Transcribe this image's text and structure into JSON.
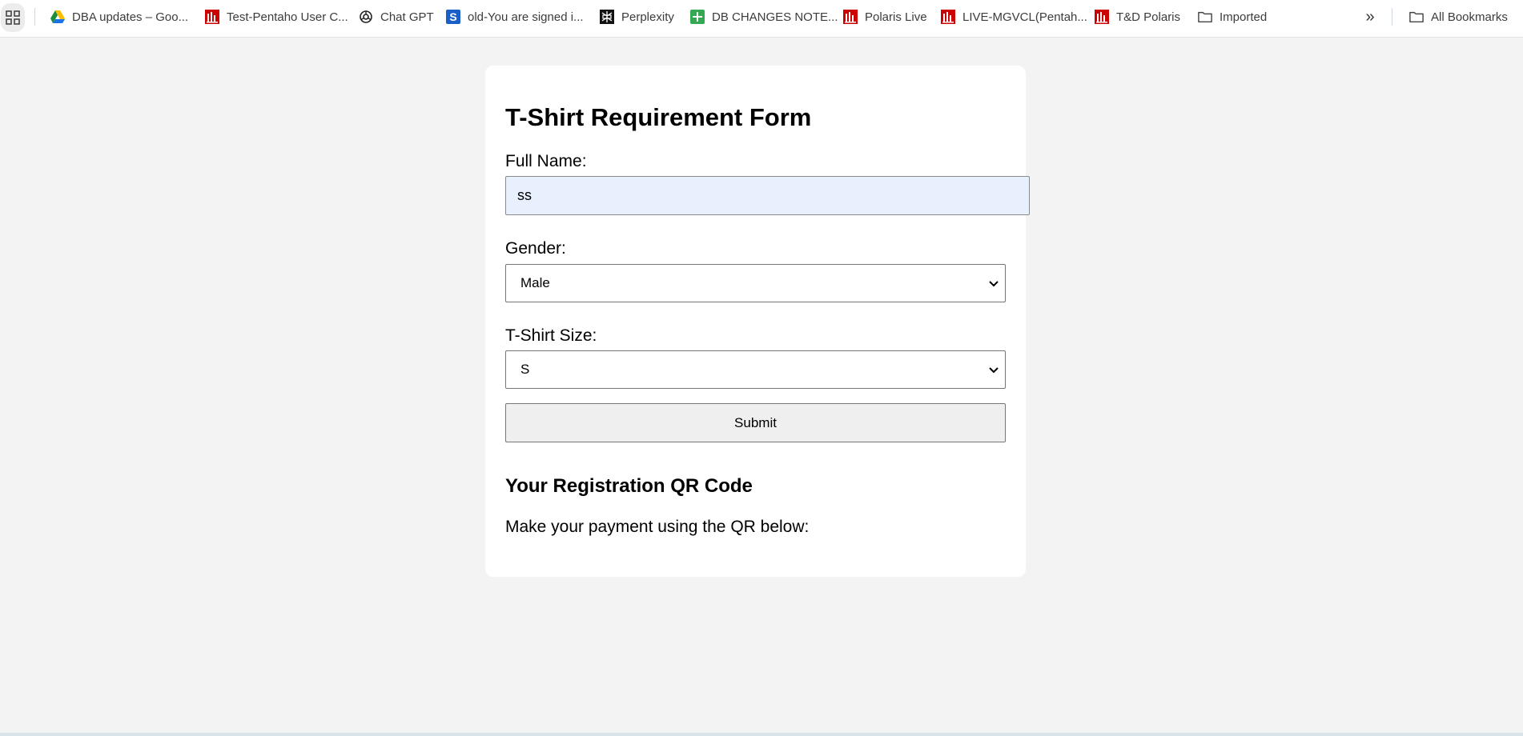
{
  "bookmarks_bar": {
    "items": [
      {
        "label": "DBA updates – Goo...",
        "icon": "google-drive-icon"
      },
      {
        "label": "Test-Pentaho User C...",
        "icon": "pentaho-report-icon"
      },
      {
        "label": "Chat GPT",
        "icon": "chatgpt-icon"
      },
      {
        "label": "old-You are signed i...",
        "icon": "s-logo-icon"
      },
      {
        "label": "Perplexity",
        "icon": "perplexity-icon"
      },
      {
        "label": "DB CHANGES NOTE...",
        "icon": "google-sheets-icon"
      },
      {
        "label": "Polaris Live",
        "icon": "pentaho-report-icon"
      },
      {
        "label": "LIVE-MGVCL(Pentah...",
        "icon": "pentaho-report-icon"
      },
      {
        "label": "T&D Polaris",
        "icon": "pentaho-report-icon"
      },
      {
        "label": "Imported",
        "icon": "folder-icon"
      }
    ],
    "more_label": "»",
    "all_bookmarks_label": "All Bookmarks"
  },
  "form": {
    "title": "T-Shirt Requirement Form",
    "full_name_label": "Full Name:",
    "full_name_value": "ss",
    "gender_label": "Gender:",
    "gender_value": "Male",
    "size_label": "T-Shirt Size:",
    "size_value": "S",
    "submit_label": "Submit"
  },
  "qr_section": {
    "heading": "Your Registration QR Code",
    "text": "Make your payment using the QR below:"
  },
  "colors": {
    "page_bg": "#f3f3f3",
    "card_bg": "#ffffff",
    "autofill_bg": "#e8f0fe",
    "button_bg": "#efefef",
    "pentaho_red": "#cc0000",
    "sheets_green": "#34a853",
    "s_logo_blue": "#1a5fc8"
  }
}
